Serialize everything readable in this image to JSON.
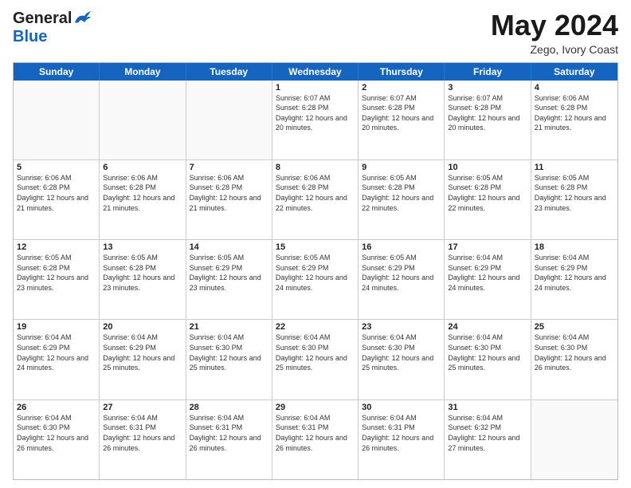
{
  "header": {
    "logo_general": "General",
    "logo_blue": "Blue",
    "month_year": "May 2024",
    "location": "Zego, Ivory Coast"
  },
  "days_of_week": [
    "Sunday",
    "Monday",
    "Tuesday",
    "Wednesday",
    "Thursday",
    "Friday",
    "Saturday"
  ],
  "weeks": [
    [
      {
        "day": "",
        "info": "",
        "empty": true
      },
      {
        "day": "",
        "info": "",
        "empty": true
      },
      {
        "day": "",
        "info": "",
        "empty": true
      },
      {
        "day": "1",
        "info": "Sunrise: 6:07 AM\nSunset: 6:28 PM\nDaylight: 12 hours and 20 minutes.",
        "empty": false
      },
      {
        "day": "2",
        "info": "Sunrise: 6:07 AM\nSunset: 6:28 PM\nDaylight: 12 hours and 20 minutes.",
        "empty": false
      },
      {
        "day": "3",
        "info": "Sunrise: 6:07 AM\nSunset: 6:28 PM\nDaylight: 12 hours and 20 minutes.",
        "empty": false
      },
      {
        "day": "4",
        "info": "Sunrise: 6:06 AM\nSunset: 6:28 PM\nDaylight: 12 hours and 21 minutes.",
        "empty": false
      }
    ],
    [
      {
        "day": "5",
        "info": "Sunrise: 6:06 AM\nSunset: 6:28 PM\nDaylight: 12 hours and 21 minutes.",
        "empty": false
      },
      {
        "day": "6",
        "info": "Sunrise: 6:06 AM\nSunset: 6:28 PM\nDaylight: 12 hours and 21 minutes.",
        "empty": false
      },
      {
        "day": "7",
        "info": "Sunrise: 6:06 AM\nSunset: 6:28 PM\nDaylight: 12 hours and 21 minutes.",
        "empty": false
      },
      {
        "day": "8",
        "info": "Sunrise: 6:06 AM\nSunset: 6:28 PM\nDaylight: 12 hours and 22 minutes.",
        "empty": false
      },
      {
        "day": "9",
        "info": "Sunrise: 6:05 AM\nSunset: 6:28 PM\nDaylight: 12 hours and 22 minutes.",
        "empty": false
      },
      {
        "day": "10",
        "info": "Sunrise: 6:05 AM\nSunset: 6:28 PM\nDaylight: 12 hours and 22 minutes.",
        "empty": false
      },
      {
        "day": "11",
        "info": "Sunrise: 6:05 AM\nSunset: 6:28 PM\nDaylight: 12 hours and 23 minutes.",
        "empty": false
      }
    ],
    [
      {
        "day": "12",
        "info": "Sunrise: 6:05 AM\nSunset: 6:28 PM\nDaylight: 12 hours and 23 minutes.",
        "empty": false
      },
      {
        "day": "13",
        "info": "Sunrise: 6:05 AM\nSunset: 6:28 PM\nDaylight: 12 hours and 23 minutes.",
        "empty": false
      },
      {
        "day": "14",
        "info": "Sunrise: 6:05 AM\nSunset: 6:29 PM\nDaylight: 12 hours and 23 minutes.",
        "empty": false
      },
      {
        "day": "15",
        "info": "Sunrise: 6:05 AM\nSunset: 6:29 PM\nDaylight: 12 hours and 24 minutes.",
        "empty": false
      },
      {
        "day": "16",
        "info": "Sunrise: 6:05 AM\nSunset: 6:29 PM\nDaylight: 12 hours and 24 minutes.",
        "empty": false
      },
      {
        "day": "17",
        "info": "Sunrise: 6:04 AM\nSunset: 6:29 PM\nDaylight: 12 hours and 24 minutes.",
        "empty": false
      },
      {
        "day": "18",
        "info": "Sunrise: 6:04 AM\nSunset: 6:29 PM\nDaylight: 12 hours and 24 minutes.",
        "empty": false
      }
    ],
    [
      {
        "day": "19",
        "info": "Sunrise: 6:04 AM\nSunset: 6:29 PM\nDaylight: 12 hours and 24 minutes.",
        "empty": false
      },
      {
        "day": "20",
        "info": "Sunrise: 6:04 AM\nSunset: 6:29 PM\nDaylight: 12 hours and 25 minutes.",
        "empty": false
      },
      {
        "day": "21",
        "info": "Sunrise: 6:04 AM\nSunset: 6:30 PM\nDaylight: 12 hours and 25 minutes.",
        "empty": false
      },
      {
        "day": "22",
        "info": "Sunrise: 6:04 AM\nSunset: 6:30 PM\nDaylight: 12 hours and 25 minutes.",
        "empty": false
      },
      {
        "day": "23",
        "info": "Sunrise: 6:04 AM\nSunset: 6:30 PM\nDaylight: 12 hours and 25 minutes.",
        "empty": false
      },
      {
        "day": "24",
        "info": "Sunrise: 6:04 AM\nSunset: 6:30 PM\nDaylight: 12 hours and 25 minutes.",
        "empty": false
      },
      {
        "day": "25",
        "info": "Sunrise: 6:04 AM\nSunset: 6:30 PM\nDaylight: 12 hours and 26 minutes.",
        "empty": false
      }
    ],
    [
      {
        "day": "26",
        "info": "Sunrise: 6:04 AM\nSunset: 6:30 PM\nDaylight: 12 hours and 26 minutes.",
        "empty": false
      },
      {
        "day": "27",
        "info": "Sunrise: 6:04 AM\nSunset: 6:31 PM\nDaylight: 12 hours and 26 minutes.",
        "empty": false
      },
      {
        "day": "28",
        "info": "Sunrise: 6:04 AM\nSunset: 6:31 PM\nDaylight: 12 hours and 26 minutes.",
        "empty": false
      },
      {
        "day": "29",
        "info": "Sunrise: 6:04 AM\nSunset: 6:31 PM\nDaylight: 12 hours and 26 minutes.",
        "empty": false
      },
      {
        "day": "30",
        "info": "Sunrise: 6:04 AM\nSunset: 6:31 PM\nDaylight: 12 hours and 26 minutes.",
        "empty": false
      },
      {
        "day": "31",
        "info": "Sunrise: 6:04 AM\nSunset: 6:32 PM\nDaylight: 12 hours and 27 minutes.",
        "empty": false
      },
      {
        "day": "",
        "info": "",
        "empty": true
      }
    ]
  ]
}
